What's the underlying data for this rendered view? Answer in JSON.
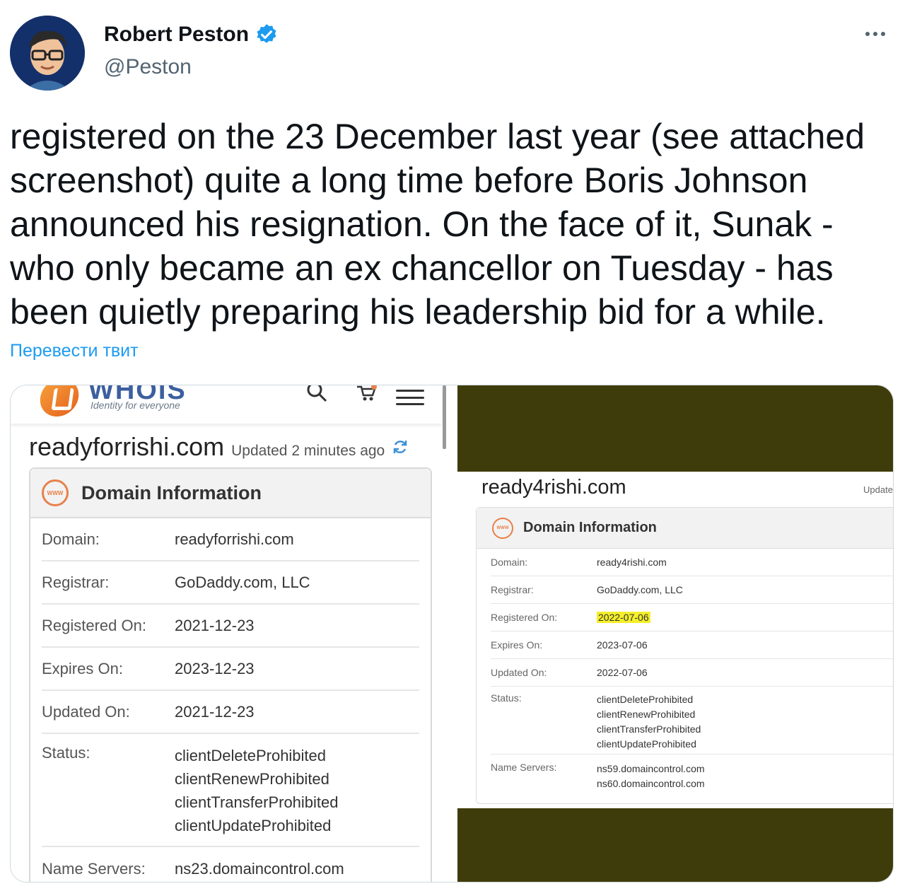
{
  "tweet": {
    "author_name": "Robert Peston",
    "author_handle": "@Peston",
    "text": "registered on the 23 December last year (see attached screenshot) quite a long time before Boris Johnson announced his resignation. On the face of it, Sunak - who only became an ex chancellor on Tuesday - has been quietly preparing his leadership bid for a while.",
    "translate_link": "Перевести твит",
    "verified_color": "#1d9bf0"
  },
  "left_screenshot": {
    "logo_text": "WHOIS",
    "tagline": "Identity for everyone",
    "domain": "readyforrishi.com",
    "updated": "Updated 2 minutes ago",
    "card_title": "Domain Information",
    "rows": [
      {
        "label": "Domain:",
        "value": "readyforrishi.com"
      },
      {
        "label": "Registrar:",
        "value": "GoDaddy.com, LLC"
      },
      {
        "label": "Registered On:",
        "value": "2021-12-23"
      },
      {
        "label": "Expires On:",
        "value": "2023-12-23"
      },
      {
        "label": "Updated On:",
        "value": "2021-12-23"
      }
    ],
    "status_label": "Status:",
    "status_values": [
      "clientDeleteProhibited",
      "clientRenewProhibited",
      "clientTransferProhibited",
      "clientUpdateProhibited"
    ],
    "ns_label": "Name Servers:",
    "ns_values": [
      "ns23.domaincontrol.com"
    ]
  },
  "right_screenshot": {
    "domain": "ready4rishi.com",
    "updated": "Update",
    "card_title": "Domain Information",
    "rows": [
      {
        "label": "Domain:",
        "value": "ready4rishi.com"
      },
      {
        "label": "Registrar:",
        "value": "GoDaddy.com, LLC"
      },
      {
        "label": "Registered On:",
        "value": "2022-07-06"
      },
      {
        "label": "Expires On:",
        "value": "2023-07-06"
      },
      {
        "label": "Updated On:",
        "value": "2022-07-06"
      }
    ],
    "status_label": "Status:",
    "status_values": [
      "clientDeleteProhibited",
      "clientRenewProhibited",
      "clientTransferProhibited",
      "clientUpdateProhibited"
    ],
    "ns_label": "Name Servers:",
    "ns_values": [
      "ns59.domaincontrol.com",
      "ns60.domaincontrol.com"
    ],
    "highlight_color": "#f4ef2a",
    "background_color": "#3f3c0b"
  }
}
